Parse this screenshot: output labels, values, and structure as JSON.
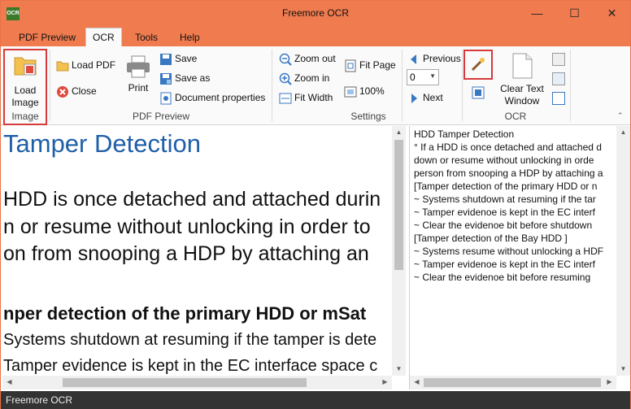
{
  "window": {
    "title": "Freemore OCR",
    "app_icon": "OCR"
  },
  "tabs": [
    {
      "label": "PDF Preview",
      "active": false
    },
    {
      "label": "OCR",
      "active": true
    },
    {
      "label": "Tools",
      "active": false
    },
    {
      "label": "Help",
      "active": false
    }
  ],
  "ribbon": {
    "image_group": {
      "label": "Image",
      "load_image": [
        "Load",
        "Image"
      ]
    },
    "pdf_preview_group": {
      "label": "PDF Preview",
      "load_pdf": "Load PDF",
      "close": "Close",
      "print": "Print",
      "save": "Save",
      "save_as": "Save as",
      "document_properties": "Document properties"
    },
    "settings_group": {
      "label": "Settings",
      "zoom_out": "Zoom out",
      "zoom_in": "Zoom in",
      "fit_width": "Fit Width",
      "fit_page": "Fit Page",
      "zoom_100": "100%",
      "page_value": "0",
      "previous": "Previous",
      "next": "Next"
    },
    "ocr_group": {
      "label": "OCR",
      "clear_text_window": [
        "Clear Text",
        "Window"
      ]
    }
  },
  "document_preview": {
    "lines": [
      "Tamper Detection",
      "HDD is once detached and attached durin",
      "n or resume without unlocking in order to",
      "on from snooping a HDP by attaching an",
      "nper detection of the primary HDD or mSat",
      "Systems shutdown at resuming if the tamper is dete",
      "Tamper evidence is kept in the EC interface space c"
    ]
  },
  "ocr_text": {
    "lines": [
      "HDD Tamper Detection",
      "° If a HDD is once detached and attached d",
      "down or resume without unlocking in orde",
      "person from snooping a HDP by attaching a",
      "[Tamper detection of the primary HDD or n",
      "~ Systems shutdown at resuming if the tar",
      "~ Tamper evidenoe is kept in the EC interf",
      "~ Clear the evidenoe bit before shutdown",
      "[Tamper detection of the Bay HDD ]",
      "~ Systems resume without unlocking a HDF",
      "~ Tamper evidenoe is kept in the EC interf",
      "~ Clear the evidenoe bit before resuming"
    ]
  },
  "status": {
    "text": "Freemore OCR"
  },
  "colors": {
    "title_bar": "#ef7b4f",
    "heading_blue": "#1f5fa8",
    "highlight_red": "#d63a3a",
    "status_bar": "#333333"
  },
  "icons": [
    "app-icon",
    "minimize-icon",
    "maximize-icon",
    "close-icon",
    "folder-image-icon",
    "folder-icon",
    "close-circle-icon",
    "printer-icon",
    "save-icon",
    "save-as-icon",
    "document-properties-icon",
    "zoom-out-icon",
    "zoom-in-icon",
    "fit-width-icon",
    "fit-page-icon",
    "zoom-100-icon",
    "previous-arrow-icon",
    "next-arrow-icon",
    "ocr-wand-icon",
    "clear-text-page-icon",
    "ocr-small-icon"
  ]
}
